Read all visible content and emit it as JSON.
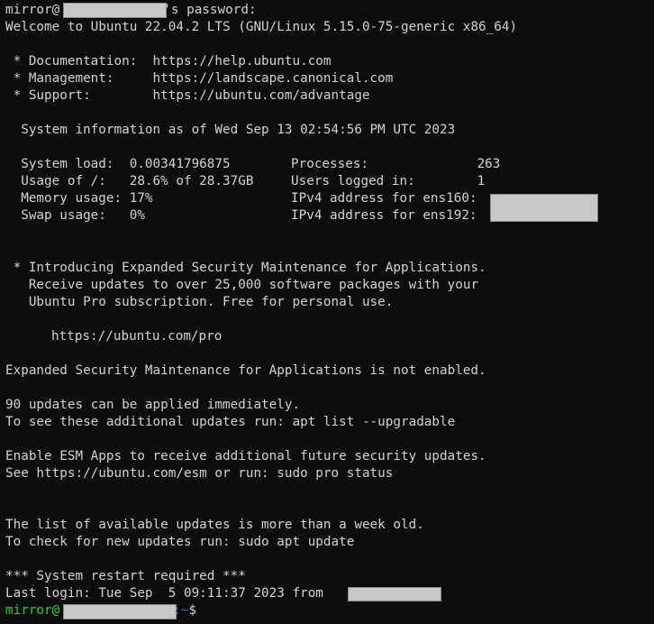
{
  "terminal": {
    "window_title": "ssh session",
    "colors": {
      "background": "#0d0d0d",
      "foreground": "#d2d2d2",
      "prompt_user_green": "#2ecc2e",
      "prompt_path_blue": "#2f6fe0",
      "redaction_fill": "#c8c8c8",
      "redaction_border": "#8a8a8a"
    },
    "password_prompt": {
      "user": "mirror@",
      "suffix": "'s password:"
    },
    "welcome": "Welcome to Ubuntu 22.04.2 LTS (GNU/Linux 5.15.0-75-generic x86_64)",
    "links": [
      {
        "label": " * Documentation:  ",
        "url": "https://help.ubuntu.com"
      },
      {
        "label": " * Management:     ",
        "url": "https://landscape.canonical.com"
      },
      {
        "label": " * Support:        ",
        "url": "https://ubuntu.com/advantage"
      }
    ],
    "system_info_header": "  System information as of Wed Sep 13 02:54:56 PM UTC 2023",
    "system_info": {
      "left": [
        {
          "label": "System load:",
          "value": "0.00341796875"
        },
        {
          "label": "Usage of /:",
          "value": "28.6% of 28.37GB"
        },
        {
          "label": "Memory usage:",
          "value": "17%"
        },
        {
          "label": "Swap usage:",
          "value": "0%"
        }
      ],
      "left_lines": [
        "  System load:  0.00341796875",
        "  Usage of /:   28.6% of 28.37GB",
        "  Memory usage: 17%",
        "  Swap usage:   0%"
      ],
      "right": [
        {
          "label": "Processes:",
          "value": "263"
        },
        {
          "label": "Users logged in:",
          "value": "1"
        },
        {
          "label": "IPv4 address for ens160:",
          "value": ""
        },
        {
          "label": "IPv4 address for ens192:",
          "value": ""
        }
      ],
      "right_lines": [
        "Processes:              263",
        "Users logged in:        1",
        "IPv4 address for ens160:",
        "IPv4 address for ens192:"
      ]
    },
    "esm_promo": [
      " * Introducing Expanded Security Maintenance for Applications.",
      "   Receive updates to over 25,000 software packages with your",
      "   Ubuntu Pro subscription. Free for personal use."
    ],
    "pro_url": "https://ubuntu.com/pro",
    "esm_status": "Expanded Security Maintenance for Applications is not enabled.",
    "updates": [
      "90 updates can be applied immediately.",
      "To see these additional updates run: apt list --upgradable"
    ],
    "esm_apps": [
      "Enable ESM Apps to receive additional future security updates.",
      "See https://ubuntu.com/esm or run: sudo pro status"
    ],
    "stale_updates": [
      "The list of available updates is more than a week old.",
      "To check for new updates run: sudo apt update"
    ],
    "restart_required": "*** System restart required ***",
    "last_login": {
      "prefix": "Last login: Tue Sep  5 09:11:37 2023 from ",
      "host": ""
    },
    "prompt": {
      "user": "mirror@",
      "host": "",
      "path": ":~",
      "symbol": "$"
    }
  }
}
